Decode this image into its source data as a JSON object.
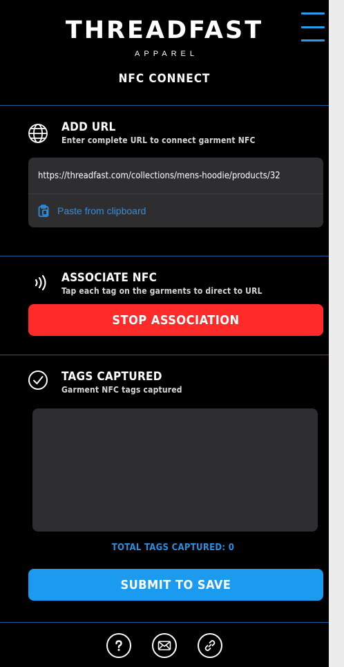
{
  "header": {
    "brand": "THREADFAST",
    "sub_brand": "APPAREL",
    "title": "NFC CONNECT",
    "menu_icon": "hamburger-icon"
  },
  "add_url": {
    "icon": "globe-icon",
    "title": "ADD URL",
    "description": "Enter complete URL to connect garment NFC",
    "url_value": "https://threadfast.com/collections/mens-hoodie/products/32",
    "paste_label": "Paste from clipboard",
    "paste_icon": "clipboard-icon"
  },
  "associate": {
    "icon": "nfc-signal-icon",
    "title": "ASSOCIATE NFC",
    "description": "Tap each tag on the garments to direct to URL",
    "button_label": "STOP ASSOCIATION",
    "button_color": "#ff2b2b"
  },
  "tags": {
    "icon": "check-circle-icon",
    "title": "TAGS CAPTURED",
    "description": "Garment NFC tags captured",
    "total_label": "TOTAL TAGS CAPTURED: 0",
    "submit_label": "SUBMIT TO SAVE",
    "submit_color": "#1a9bf0"
  },
  "footer": {
    "icons": [
      "help-icon",
      "mail-icon",
      "link-icon"
    ]
  },
  "colors": {
    "accent": "#2b9de8",
    "background": "#000000",
    "card": "#2e2e31"
  }
}
